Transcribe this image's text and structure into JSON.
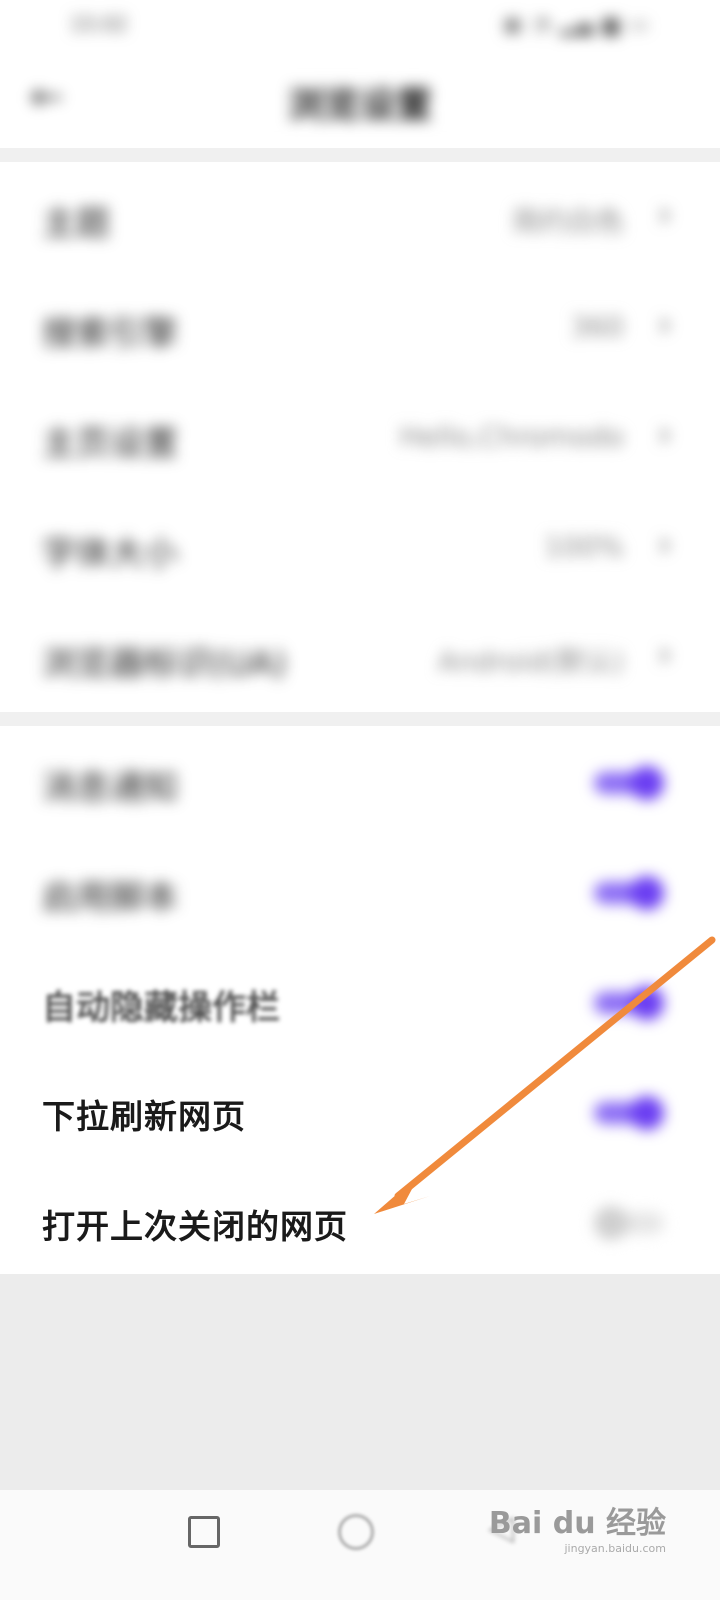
{
  "statusbar": {
    "time": "15:02",
    "icons": "▣ ◔ ▂▄ ▆ ▭"
  },
  "header": {
    "back_icon": "arrow-left-icon",
    "title": "浏览设置"
  },
  "settings_links": [
    {
      "label": "主题",
      "value": "简约白色"
    },
    {
      "label": "搜索引擎",
      "value": "360"
    },
    {
      "label": "主页设置",
      "value": "Hello,Chromodo"
    },
    {
      "label": "字体大小",
      "value": "100%"
    },
    {
      "label": "浏览器标识(UA)",
      "value": "Android(默认)"
    }
  ],
  "settings_toggles": [
    {
      "label": "消息通知",
      "on": true
    },
    {
      "label": "启用脚本",
      "on": true
    },
    {
      "label": "自动隐藏操作栏",
      "on": true
    },
    {
      "label": "下拉刷新网页",
      "on": true
    },
    {
      "label": "打开上次关闭的网页",
      "on": false
    }
  ],
  "annotation": {
    "arrow_color": "#f08a3c"
  },
  "colors": {
    "toggle_on": "#6a3df2",
    "toggle_off": "#cfcfcf",
    "background": "#ffffff",
    "separator": "#f0f0f0"
  },
  "watermark": {
    "brand": "Bai du 经验",
    "url": "jingyan.baidu.com"
  }
}
